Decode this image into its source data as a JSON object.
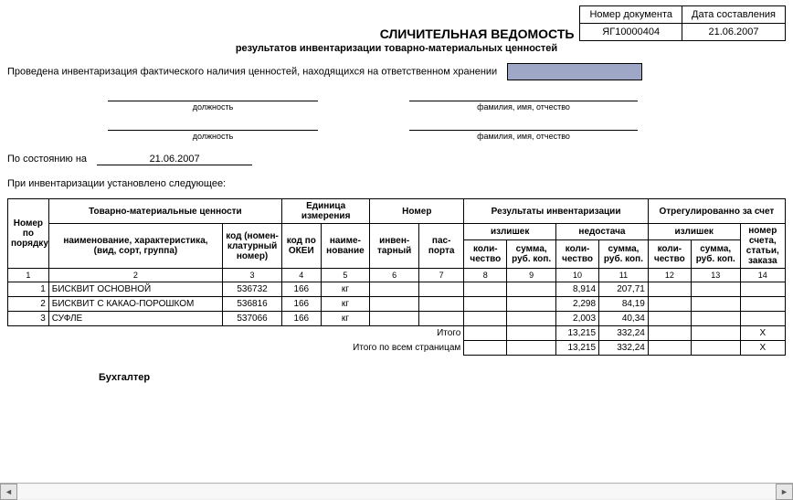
{
  "header": {
    "doc_num_label": "Номер документа",
    "doc_date_label": "Дата составления",
    "doc_num": "ЯГ10000404",
    "doc_date": "21.06.2007",
    "title": "СЛИЧИТЕЛЬНАЯ ВЕДОМОСТЬ",
    "subtitle": "результатов инвентаризации товарно-материальных ценностей"
  },
  "intro": "Проведена инвентаризация фактического наличия ценностей, находящихся на ответственном хранении",
  "sig": {
    "position": "должность",
    "fio": "фамилия, имя, отчество"
  },
  "state": {
    "label": "По состоянию на",
    "date": "21.06.2007"
  },
  "note": "При инвентаризации установлено следующее:",
  "cols": {
    "order": "Номер по порядку",
    "tmc": "Товарно-материальные ценности",
    "name": "наименование, характеристика, (вид, сорт, группа)",
    "code": "код (номен- клатурный номер)",
    "unit": "Единица измерения",
    "okei": "код по ОКЕИ",
    "unitname": "наиме- нование",
    "number": "Номер",
    "inv": "инвен- тарный",
    "pass": "пас- порта",
    "results": "Результаты инвентаризации",
    "surplus": "излишек",
    "shortage": "недостача",
    "qty": "коли- чество",
    "sum": "сумма, руб. коп.",
    "adjusted": "Отрегулированно за счет",
    "acct": "номер счета, статьи, заказа"
  },
  "rows": [
    {
      "n": "1",
      "name": "БИСКВИТ ОСНОВНОЙ",
      "code": "536732",
      "okei": "166",
      "unit": "кг",
      "short_qty": "8,914",
      "short_sum": "207,71"
    },
    {
      "n": "2",
      "name": "БИСКВИТ С КАКАО-ПОРОШКОМ",
      "code": "536816",
      "okei": "166",
      "unit": "кг",
      "short_qty": "2,298",
      "short_sum": "84,19"
    },
    {
      "n": "3",
      "name": "СУФЛЕ",
      "code": "537066",
      "okei": "166",
      "unit": "кг",
      "short_qty": "2,003",
      "short_sum": "40,34"
    }
  ],
  "totals": {
    "label1": "Итого",
    "label2": "Итого по всем страницам",
    "short_qty": "13,215",
    "short_sum": "332,24",
    "x": "Х"
  },
  "footer": {
    "accountant": "Бухгалтер"
  },
  "colnums": [
    "1",
    "2",
    "3",
    "4",
    "5",
    "6",
    "7",
    "8",
    "9",
    "10",
    "11",
    "12",
    "13",
    "14"
  ]
}
